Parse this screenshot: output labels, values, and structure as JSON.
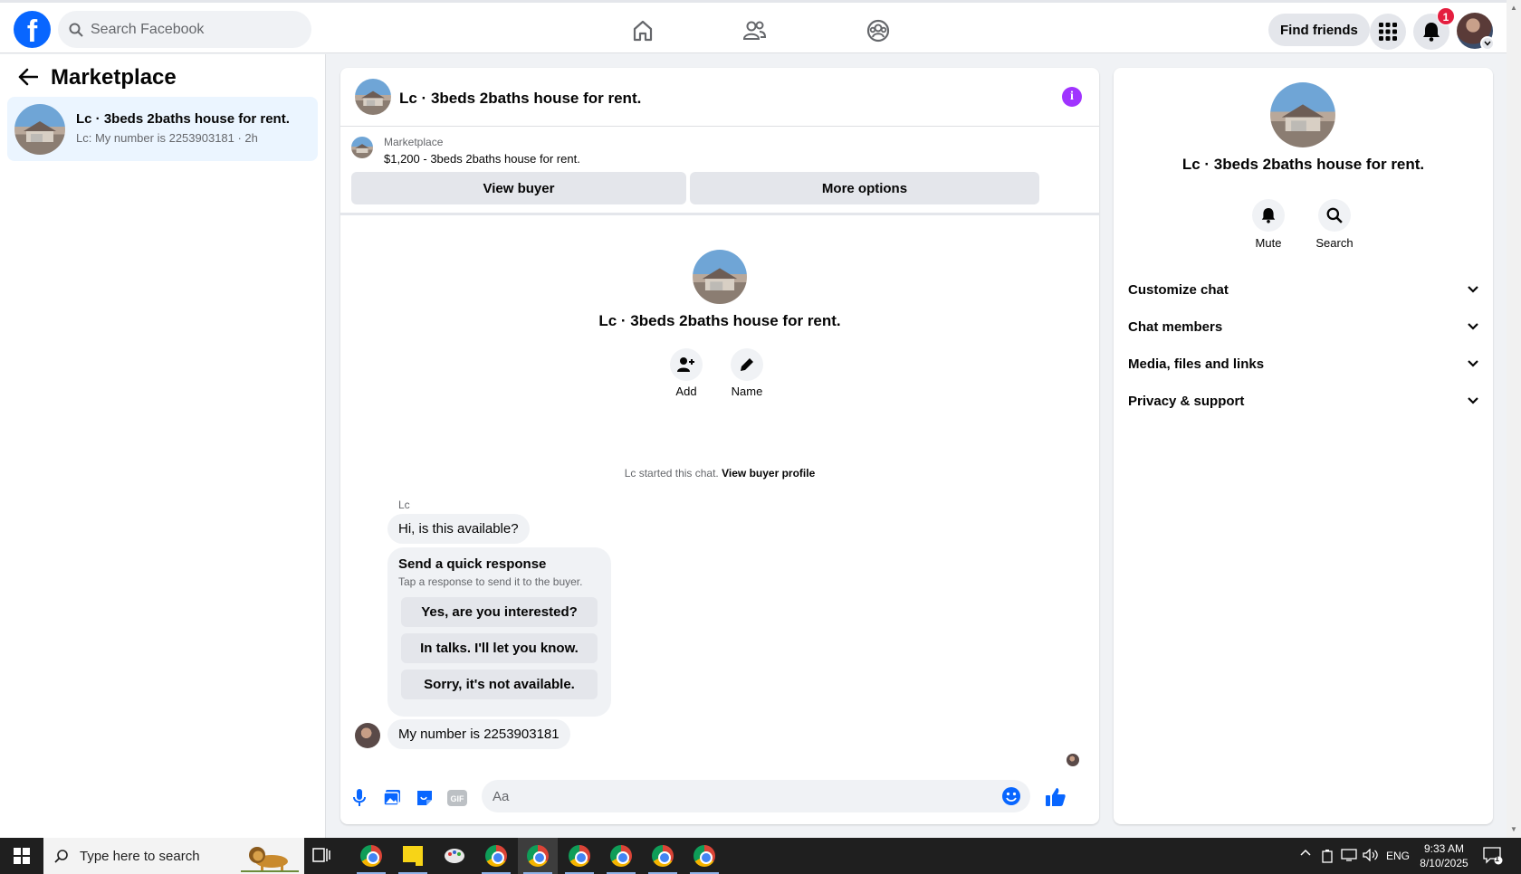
{
  "topbar": {
    "search_placeholder": "Search Facebook",
    "find_friends_label": "Find friends",
    "notification_count": "1"
  },
  "sidebar": {
    "title": "Marketplace",
    "conversation": {
      "title": "Lc · 3beds 2baths house for rent.",
      "subtitle": "Lc: My number is 2253903181 · 2h"
    }
  },
  "chat": {
    "header_title": "Lc · 3beds 2baths house for rent.",
    "listing_label": "Marketplace",
    "listing_title": "$1,200 - 3beds 2baths house for rent.",
    "view_buyer_label": "View buyer",
    "more_options_label": "More options",
    "center_title": "Lc · 3beds 2baths house for rent.",
    "add_label": "Add",
    "name_label": "Name",
    "started_text": "Lc started this chat.",
    "view_buyer_profile_label": "View buyer profile",
    "sender_name": "Lc",
    "messages": [
      "Hi, is this available?",
      "My number is 2253903181"
    ],
    "quick_response": {
      "title": "Send a quick response",
      "subtitle": "Tap a response to send it to the buyer.",
      "options": [
        "Yes, are you interested?",
        "In talks. I'll let you know.",
        "Sorry, it's not available."
      ]
    },
    "composer_placeholder": "Aa"
  },
  "details": {
    "title": "Lc · 3beds 2baths house for rent.",
    "mute_label": "Mute",
    "search_label": "Search",
    "sections": [
      "Customize chat",
      "Chat members",
      "Media, files and links",
      "Privacy & support"
    ]
  },
  "taskbar": {
    "search_placeholder": "Type here to search",
    "language": "ENG",
    "time": "9:33 AM",
    "date": "8/10/2025",
    "notification_count": "1"
  },
  "colors": {
    "brand": "#0866ff",
    "info": "#a033ff",
    "badge": "#e41e3f"
  }
}
